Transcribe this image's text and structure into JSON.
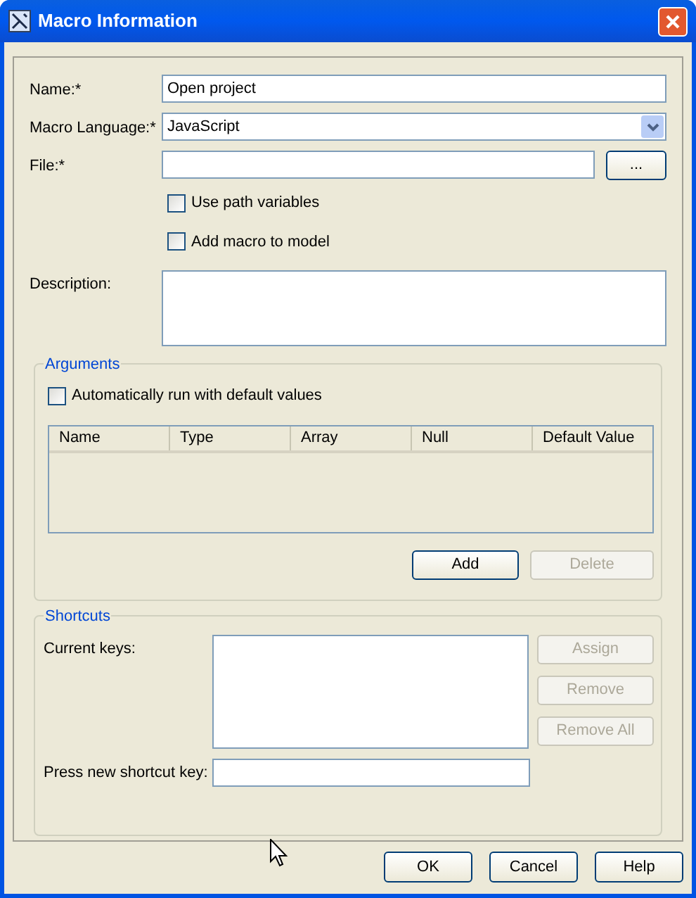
{
  "window": {
    "title": "Macro Information"
  },
  "fields": [
    {
      "kind": "text",
      "label": "Name:*",
      "value": "Open project"
    },
    {
      "kind": "select",
      "label": "Macro Language:*",
      "value": "JavaScript"
    },
    {
      "kind": "file",
      "label": "File:*",
      "button": "..."
    }
  ],
  "options": [
    {
      "label": "Use path variables",
      "checked": false
    },
    {
      "label": "Add macro to model",
      "checked": false
    }
  ],
  "description": {
    "label": "Description:"
  },
  "arguments": {
    "title": "Arguments",
    "auto_run": {
      "label": "Automatically run with default values",
      "checked": false
    },
    "columns": [
      "Name",
      "Type",
      "Array",
      "Null",
      "Default Value"
    ],
    "buttons": [
      {
        "label": "Add",
        "disabled": false
      },
      {
        "label": "Delete",
        "disabled": true
      }
    ]
  },
  "shortcuts": {
    "title": "Shortcuts",
    "current_keys_label": "Current keys:",
    "new_key_label": "Press new shortcut key:",
    "buttons": [
      {
        "label": "Assign",
        "disabled": true
      },
      {
        "label": "Remove",
        "disabled": true
      },
      {
        "label": "Remove All",
        "disabled": true
      }
    ]
  },
  "footer_buttons": [
    {
      "label": "OK"
    },
    {
      "label": "Cancel"
    },
    {
      "label": "Help"
    }
  ]
}
